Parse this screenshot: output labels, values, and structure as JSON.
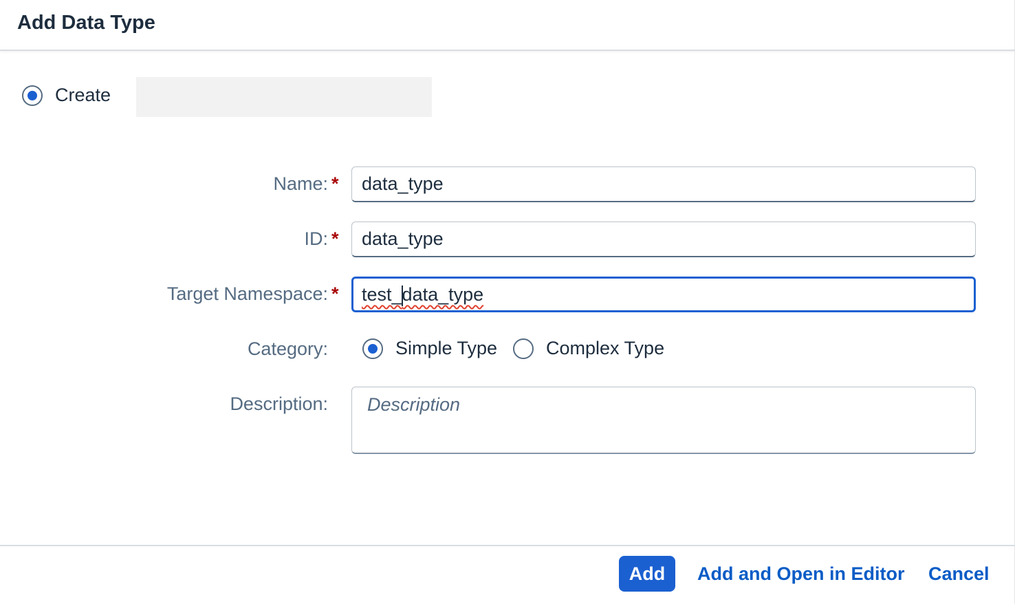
{
  "dialog": {
    "title": "Add Data Type"
  },
  "mode": {
    "create_label": "Create",
    "selected": "create"
  },
  "form": {
    "name": {
      "label": "Name:",
      "required": "*",
      "value": "data_type"
    },
    "id": {
      "label": "ID:",
      "required": "*",
      "value": "data_type"
    },
    "namespace": {
      "label": "Target Namespace:",
      "required": "*",
      "value_before_caret": "test_",
      "value_after_caret": "data_type"
    },
    "category": {
      "label": "Category:",
      "options": [
        "Simple Type",
        "Complex Type"
      ],
      "selected": "Simple Type"
    },
    "description": {
      "label": "Description:",
      "placeholder": "Description",
      "value": ""
    }
  },
  "footer": {
    "add_label": "Add",
    "add_open_label": "Add and Open in Editor",
    "cancel_label": "Cancel"
  },
  "colors": {
    "accent": "#1b60d1",
    "required": "#aa0808",
    "label": "#556b82",
    "text": "#1d2d3e"
  }
}
